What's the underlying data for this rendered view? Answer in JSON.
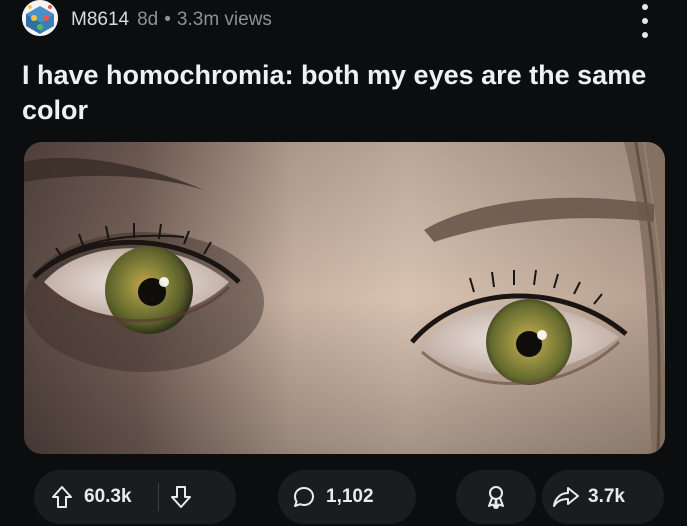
{
  "post": {
    "author": "M8614",
    "age": "8d",
    "separator": "•",
    "views": "3.3m views",
    "title": "I have homochromia: both my eyes are the same color"
  },
  "image": {
    "description_icon": "photo-of-two-hazel-eyes"
  },
  "actions": {
    "upvotes": "60.3k",
    "comments": "1,102",
    "shares": "3.7k"
  },
  "icons": {
    "avatar": "subreddit-avatar-icon",
    "more": "kebab-menu-icon",
    "upvote": "upvote-arrow-icon",
    "downvote": "downvote-arrow-icon",
    "comment": "comment-bubble-icon",
    "award": "award-icon",
    "share": "share-arrow-icon"
  },
  "colors": {
    "background": "#0b0d0f",
    "pill": "#1a1d20",
    "text": "#e9ecee",
    "muted": "#8b9296"
  }
}
